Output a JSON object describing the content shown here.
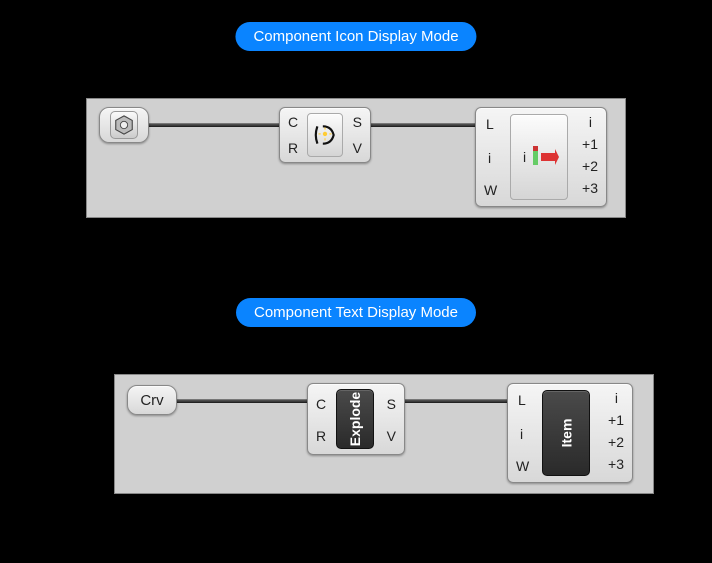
{
  "badges": {
    "icon_mode": "Component Icon Display Mode",
    "text_mode": "Component Text Display Mode"
  },
  "param_text": "Crv",
  "explode": {
    "in": [
      "C",
      "R"
    ],
    "out": [
      "S",
      "V"
    ],
    "label": "Explode"
  },
  "list_item": {
    "in": [
      "L",
      "i",
      "W"
    ],
    "out": [
      "i",
      "+1",
      "+2",
      "+3"
    ],
    "label": "Item",
    "center_text": "i"
  }
}
